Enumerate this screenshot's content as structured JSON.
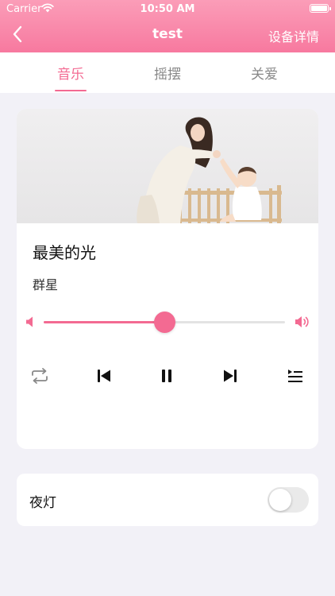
{
  "status_bar": {
    "carrier": "Carrier",
    "time": "10:50 AM"
  },
  "nav": {
    "title": "test",
    "right_action": "设备详情"
  },
  "tabs": [
    {
      "label": "音乐",
      "active": true
    },
    {
      "label": "摇摆",
      "active": false
    },
    {
      "label": "关爱",
      "active": false
    }
  ],
  "player": {
    "song_title": "最美的光",
    "artist": "群星",
    "volume": 0.5
  },
  "night_light": {
    "label": "夜灯",
    "enabled": false
  },
  "colors": {
    "accent": "#f36a92",
    "header_top": "#fb9db8",
    "header_bottom": "#f7799f",
    "background": "#f2f1f7"
  },
  "icons": [
    "wifi-icon",
    "battery-icon",
    "back-arrow-icon",
    "volume-low-icon",
    "volume-high-icon",
    "repeat-icon",
    "previous-icon",
    "pause-icon",
    "next-icon",
    "playlist-icon"
  ]
}
